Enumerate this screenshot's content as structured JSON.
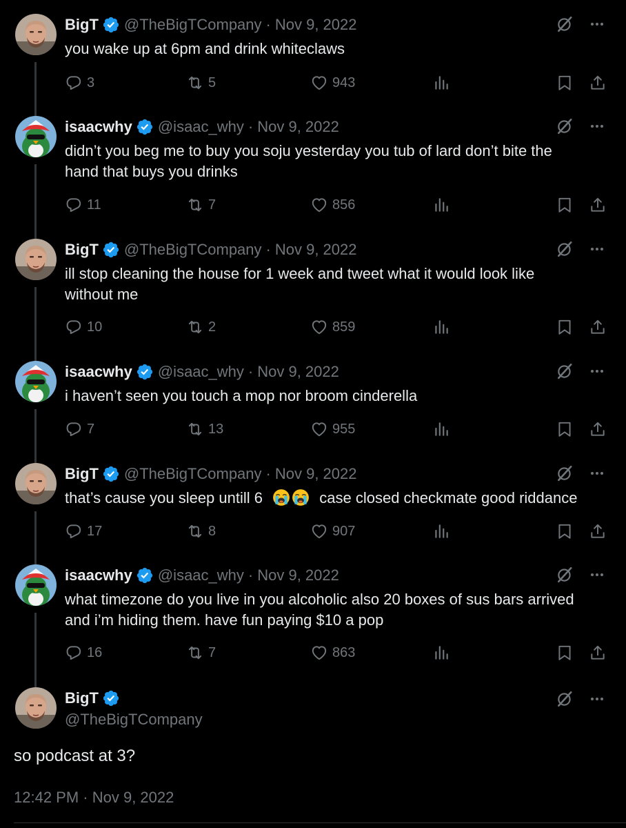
{
  "colors": {
    "background": "#000000",
    "text": "#e7e9ea",
    "muted": "#71767b",
    "verified": "#1d9bf0",
    "thread_line": "#333639"
  },
  "tweets": [
    {
      "name": "BigT",
      "handle": "@TheBigTCompany",
      "separator": "·",
      "date": "Nov 9, 2022",
      "text_lines": [
        "you wake up at 6pm and drink whiteclaws"
      ],
      "replies": "3",
      "retweets": "5",
      "likes": "943",
      "avatar": "man-avatar"
    },
    {
      "name": "isaacwhy",
      "handle": "@isaac_why",
      "separator": "·",
      "date": "Nov 9, 2022",
      "text_lines": [
        "didn’t you beg me to buy you soju yesterday you tub of lard don’t bite the",
        "hand that buys you drinks"
      ],
      "replies": "11",
      "retweets": "7",
      "likes": "856",
      "avatar": "penguin-avatar"
    },
    {
      "name": "BigT",
      "handle": "@TheBigTCompany",
      "separator": "·",
      "date": "Nov 9, 2022",
      "text_lines": [
        "ill stop cleaning the house for 1 week and tweet what it would look like",
        "without me"
      ],
      "replies": "10",
      "retweets": "2",
      "likes": "859",
      "avatar": "man-avatar"
    },
    {
      "name": "isaacwhy",
      "handle": "@isaac_why",
      "separator": "·",
      "date": "Nov 9, 2022",
      "text_lines": [
        "i haven’t seen you touch a mop nor broom cinderella"
      ],
      "replies": "7",
      "retweets": "13",
      "likes": "955",
      "avatar": "penguin-avatar"
    },
    {
      "name": "BigT",
      "handle": "@TheBigTCompany",
      "separator": "·",
      "date": "Nov 9, 2022",
      "text_before_emoji": "that’s cause you sleep untill 6",
      "text_after_emoji": "case closed checkmate good riddance",
      "emoji": "loudly-crying-face-emoji",
      "replies": "17",
      "retweets": "8",
      "likes": "907",
      "avatar": "man-avatar"
    },
    {
      "name": "isaacwhy",
      "handle": "@isaac_why",
      "separator": "·",
      "date": "Nov 9, 2022",
      "text_lines": [
        "what timezone do you live in you alcoholic also 20 boxes of sus bars arrived",
        "and i’m hiding them. have fun paying $10 a pop"
      ],
      "replies": "16",
      "retweets": "7",
      "likes": "863",
      "avatar": "penguin-avatar"
    }
  ],
  "main_tweet": {
    "name": "BigT",
    "handle": "@TheBigTCompany",
    "text": "so podcast at 3?",
    "timestamp": "12:42 PM · Nov 9, 2022"
  }
}
